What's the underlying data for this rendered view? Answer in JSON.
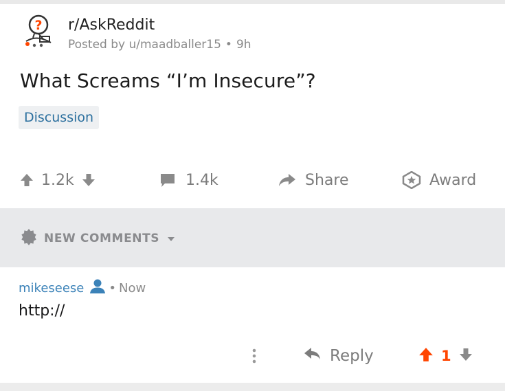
{
  "post": {
    "subreddit": "r/AskReddit",
    "posted_by": "Posted by u/maadballer15",
    "separator": "•",
    "age": "9h",
    "title": "What Screams “I’m Insecure”?",
    "flair": "Discussion"
  },
  "actions": {
    "vote_count": "1.2k",
    "comment_count": "1.4k",
    "share_label": "Share",
    "award_label": "Award"
  },
  "sort": {
    "label": "NEW COMMENTS"
  },
  "comment": {
    "username": "mikeseese",
    "separator": "•",
    "timestamp": "Now",
    "body": "http://",
    "reply_label": "Reply",
    "vote_count": "1"
  },
  "colors": {
    "upvote_active": "#ff4500",
    "username": "#3b82b8",
    "flair_text": "#2b6f9e",
    "muted": "#7c7c7c"
  },
  "icons": {
    "subreddit": "askreddit-snoo-icon",
    "upvote": "arrow-up-icon",
    "downvote": "arrow-down-icon",
    "comments": "comment-bubble-icon",
    "share": "share-arrow-icon",
    "award": "award-icon",
    "sort": "sort-badge-icon",
    "user": "user-icon",
    "more": "more-vertical-icon",
    "reply": "reply-arrow-icon"
  }
}
